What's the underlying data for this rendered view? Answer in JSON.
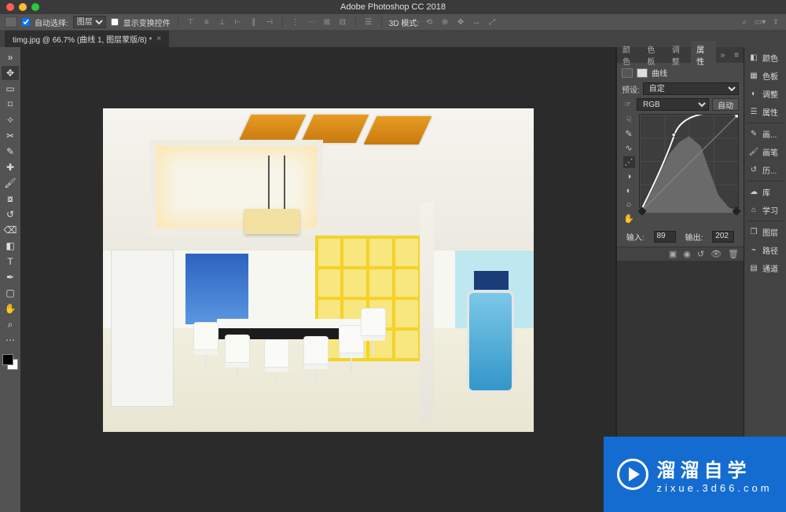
{
  "app": {
    "title": "Adobe Photoshop CC 2018"
  },
  "option_bar": {
    "auto_select_checked": true,
    "auto_select_label": "自动选择:",
    "auto_select_value": "图层",
    "transform_label": "显示变换控件",
    "mode_label": "3D 模式:"
  },
  "tab": {
    "label": "timg.jpg @ 66.7% (曲线 1, 图层蒙版/8) *"
  },
  "panel_tabs": [
    "颜色",
    "色板",
    "调整",
    "属性"
  ],
  "panel_active_tab": 3,
  "curves_panel": {
    "header_icon1": "adjustment-icon",
    "header_icon2": "mask-icon",
    "title": "曲线",
    "preset_label": "预设:",
    "preset_value": "自定",
    "channel_value": "RGB",
    "auto_button": "自动",
    "input_label": "输入:",
    "input_value": "89",
    "output_label": "输出:",
    "output_value": "202",
    "tool_icons": [
      "finger-icon",
      "pencil-icon",
      "smooth-icon",
      "curve-icon",
      "eyedropper-black-icon",
      "eyedropper-gray-icon",
      "eyedropper-white-icon",
      "hand-icon"
    ]
  },
  "right_toolbar": [
    {
      "icon": "color-icon",
      "label": "颜色"
    },
    {
      "icon": "swatches-icon",
      "label": "色板"
    },
    {
      "icon": "adjustments-icon",
      "label": "调整"
    },
    {
      "icon": "properties-icon",
      "label": "属性"
    },
    {
      "divider": true
    },
    {
      "icon": "brushes-icon",
      "label": "画..."
    },
    {
      "icon": "brush-settings-icon",
      "label": "画笔"
    },
    {
      "icon": "history-icon",
      "label": "历..."
    },
    {
      "divider": true
    },
    {
      "icon": "libraries-icon",
      "label": "库"
    },
    {
      "icon": "learn-icon",
      "label": "学习"
    },
    {
      "divider": true
    },
    {
      "icon": "layers-icon",
      "label": "图层"
    },
    {
      "icon": "paths-icon",
      "label": "路径"
    },
    {
      "icon": "channels-icon",
      "label": "通道"
    }
  ],
  "left_tools": [
    "move",
    "marquee",
    "lasso",
    "wand",
    "crop",
    "eyedropper",
    "heal",
    "brush",
    "stamp",
    "history-brush",
    "eraser",
    "gradient",
    "blur",
    "dodge",
    "pen",
    "type",
    "path",
    "rect",
    "hand",
    "zoom"
  ],
  "watermark": {
    "brand": "溜溜自学",
    "site": "zixue.3d66.com"
  },
  "chart_data": {
    "type": "line",
    "title": "曲线",
    "channel": "RGB",
    "xlabel": "输入",
    "ylabel": "输出",
    "xlim": [
      0,
      255
    ],
    "ylim": [
      0,
      255
    ],
    "x": [
      0,
      89,
      255
    ],
    "y": [
      0,
      202,
      255
    ],
    "reference_line": {
      "x": [
        0,
        255
      ],
      "y": [
        0,
        255
      ]
    },
    "histogram_present": true
  }
}
